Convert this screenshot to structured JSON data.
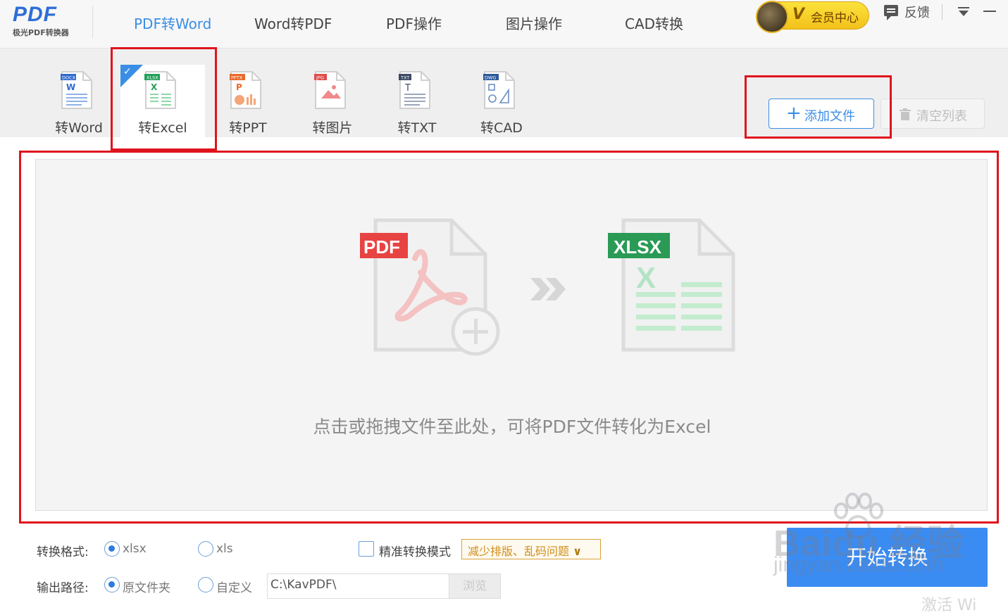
{
  "app": {
    "logo_text": "PDF",
    "logo_subtitle": "极光PDF转换器"
  },
  "nav": {
    "tabs": [
      {
        "label": "PDF转Word",
        "active": true
      },
      {
        "label": "Word转PDF",
        "active": false
      },
      {
        "label": "PDF操作",
        "active": false
      },
      {
        "label": "图片操作",
        "active": false
      },
      {
        "label": "CAD转换",
        "active": false
      }
    ],
    "vip_label": "会员中心",
    "vip_badge": "V",
    "feedback_label": "反馈"
  },
  "tools": [
    {
      "label": "转Word",
      "badge": "DOCX",
      "color": "#2f6ad0",
      "active": false
    },
    {
      "label": "转Excel",
      "badge": "XLSX",
      "color": "#24a05a",
      "active": true
    },
    {
      "label": "转PPT",
      "badge": "PPTX",
      "color": "#e8692a",
      "active": false
    },
    {
      "label": "转图片",
      "badge": "JPG",
      "color": "#e04b4b",
      "active": false
    },
    {
      "label": "转TXT",
      "badge": "TXT",
      "color": "#3c4a63",
      "active": false
    },
    {
      "label": "转CAD",
      "badge": "DWG",
      "color": "#2c5a9c",
      "active": false
    }
  ],
  "actions": {
    "add_file": "添加文件",
    "clear_list": "清空列表"
  },
  "drop_zone": {
    "source_badge": "PDF",
    "target_badge": "XLSX",
    "hint": "点击或拖拽文件至此处，可将PDF文件转化为Excel"
  },
  "options": {
    "format_label": "转换格式:",
    "format_options": [
      {
        "label": "xlsx",
        "selected": true
      },
      {
        "label": "xls",
        "selected": false
      }
    ],
    "precise_mode_label": "精准转换模式",
    "precise_mode_checked": false,
    "precise_tag": "减少排版、乱码问题",
    "output_label": "输出路径:",
    "output_options": [
      {
        "label": "原文件夹",
        "selected": true
      },
      {
        "label": "自定义",
        "selected": false
      }
    ],
    "output_path": "C:\\KavPDF\\",
    "browse_label": "浏览",
    "start_label": "开始转换"
  },
  "watermark": {
    "brand": "Baidu 经验",
    "url": "jingyan.baidu.com",
    "footer": "激活 Wi"
  },
  "colors": {
    "accent": "#3a8ee6",
    "annotation": "#e0141d",
    "start_button": "#3b8cf2",
    "pdf_red": "#e84343",
    "xlsx_green": "#24a05a"
  }
}
